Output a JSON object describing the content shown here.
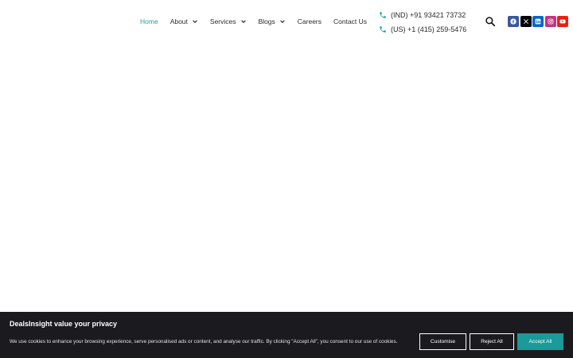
{
  "nav": {
    "items": [
      {
        "label": "Home",
        "active": true,
        "has_dropdown": false
      },
      {
        "label": "About",
        "active": false,
        "has_dropdown": true
      },
      {
        "label": "Services",
        "active": false,
        "has_dropdown": true
      },
      {
        "label": "Blogs",
        "active": false,
        "has_dropdown": true
      },
      {
        "label": "Careers",
        "active": false,
        "has_dropdown": false
      },
      {
        "label": "Contact Us",
        "active": false,
        "has_dropdown": false
      }
    ]
  },
  "contact": {
    "phones": [
      "(IND) +91 93421 73732",
      "(US) +1 (415) 259-5476"
    ],
    "icon": "phone-icon",
    "icon_color": "#1aa3a3"
  },
  "header_icons": {
    "search": "search-icon"
  },
  "social": [
    {
      "name": "facebook-icon",
      "color": "#3b5998"
    },
    {
      "name": "x-icon",
      "color": "#000000"
    },
    {
      "name": "linkedin-icon",
      "color": "#0a66c2"
    },
    {
      "name": "instagram-icon",
      "color": "#c13584"
    },
    {
      "name": "youtube-icon",
      "color": "#e62117"
    }
  ],
  "cookie_banner": {
    "title": "DealsInsight value your privacy",
    "text": "We use cookies to enhance your browsing experience, serve personalised ads or content, and analyse our traffic. By clicking \"Accept All\", you consent to our use of cookies.",
    "buttons": {
      "customise": "Customise",
      "reject": "Reject All",
      "accept": "Accept All"
    },
    "background": "#1b1b1f",
    "accent": "#1a9a9a"
  },
  "colors": {
    "accent": "#1aa3a3",
    "text": "#2b2b2b",
    "background": "#ffffff"
  }
}
